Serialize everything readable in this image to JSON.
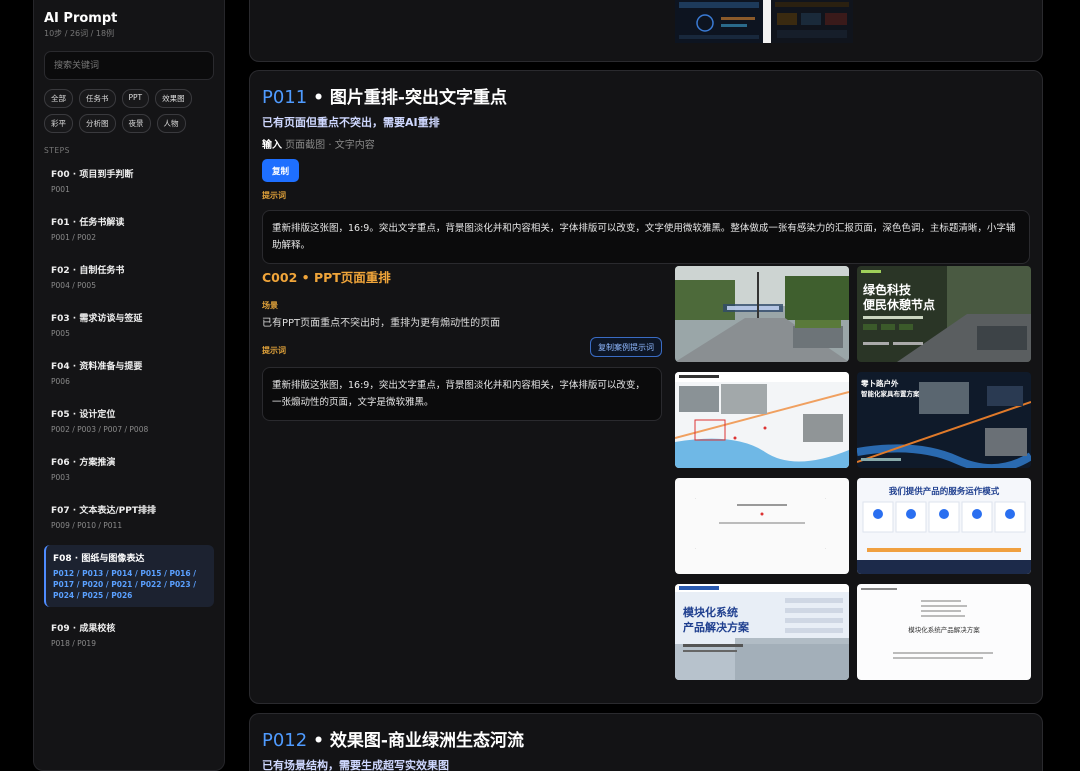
{
  "app": {
    "title": "AI Prompt",
    "subtitle": "10步 / 26词 / 18例"
  },
  "search": {
    "placeholder": "搜索关键词"
  },
  "filters": [
    "全部",
    "任务书",
    "PPT",
    "效果图",
    "彩平",
    "分析图",
    "夜景",
    "人物"
  ],
  "steps_label": "STEPS",
  "steps": [
    {
      "title": "F00 · 项目到手判断",
      "codes": "P001"
    },
    {
      "title": "F01 · 任务书解读",
      "codes": "P001 / P002"
    },
    {
      "title": "F02 · 自制任务书",
      "codes": "P004 / P005"
    },
    {
      "title": "F03 · 需求访谈与签延",
      "codes": "P005"
    },
    {
      "title": "F04 · 资料准备与提要",
      "codes": "P006"
    },
    {
      "title": "F05 · 设计定位",
      "codes": "P002 / P003 / P007 / P008"
    },
    {
      "title": "F06 · 方案推演",
      "codes": "P003"
    },
    {
      "title": "F07 · 文本表达/PPT排排",
      "codes": "P009 / P010 / P011"
    },
    {
      "title": "F08 · 图纸与图像表达",
      "codes": "P012 / P013 / P014 / P015 / P016 / P017 / P020 / P021 / P022 / P023 / P024 / P025 / P026",
      "active": true
    },
    {
      "title": "F09 · 成果校核",
      "codes": "P018 / P019"
    }
  ],
  "main": {
    "p011": {
      "code": "P011",
      "title": " • 图片重排-突出文字重点",
      "subtitle": "已有页面但重点不突出，需要AI重排",
      "input_label": "输入",
      "input_value": " 页面截图 · 文字内容",
      "copy_label": "复制",
      "prompt_label": "提示词",
      "prompt": "重新排版这张图，16:9。突出文字重点，背景图淡化并和内容相关，字体排版可以改变，文字使用微软雅黑。整体做成一张有感染力的汇报页面，深色色调，主标题清晰，小字辅助解释。"
    },
    "case": {
      "title": "C002 • PPT页面重排",
      "scene_label": "场景",
      "scene": "已有PPT页面重点不突出时，重排为更有煽动性的页面",
      "prompt_label": "提示词",
      "copy_case_label": "复制案例提示词",
      "prompt": "重新排版这张图，16:9，突出文字重点，背景图淡化并和内容相关，字体排版可以改变，一张煽动性的页面，文字是微软雅黑。"
    },
    "gallery": {
      "g2_title1": "绿色科技",
      "g2_title2": "便民休憩节点",
      "g4_title1": "零卜路户外",
      "g4_title2": "智能化家具布置方案",
      "g6_title": "我们提供产品的服务运作模式",
      "g7_title1": "模块化系统",
      "g7_title2": "产品解决方案",
      "g8_title": "模块化系统产品解决方案"
    },
    "p012": {
      "code": "P012",
      "title": " • 效果图-商业绿洲生态河流",
      "subtitle": "已有场景结构，需要生成超写实效果图"
    }
  },
  "colors": {
    "accent_blue": "#4f9bff",
    "accent_orange": "#f0a53a",
    "button_blue": "#1e6fff"
  }
}
